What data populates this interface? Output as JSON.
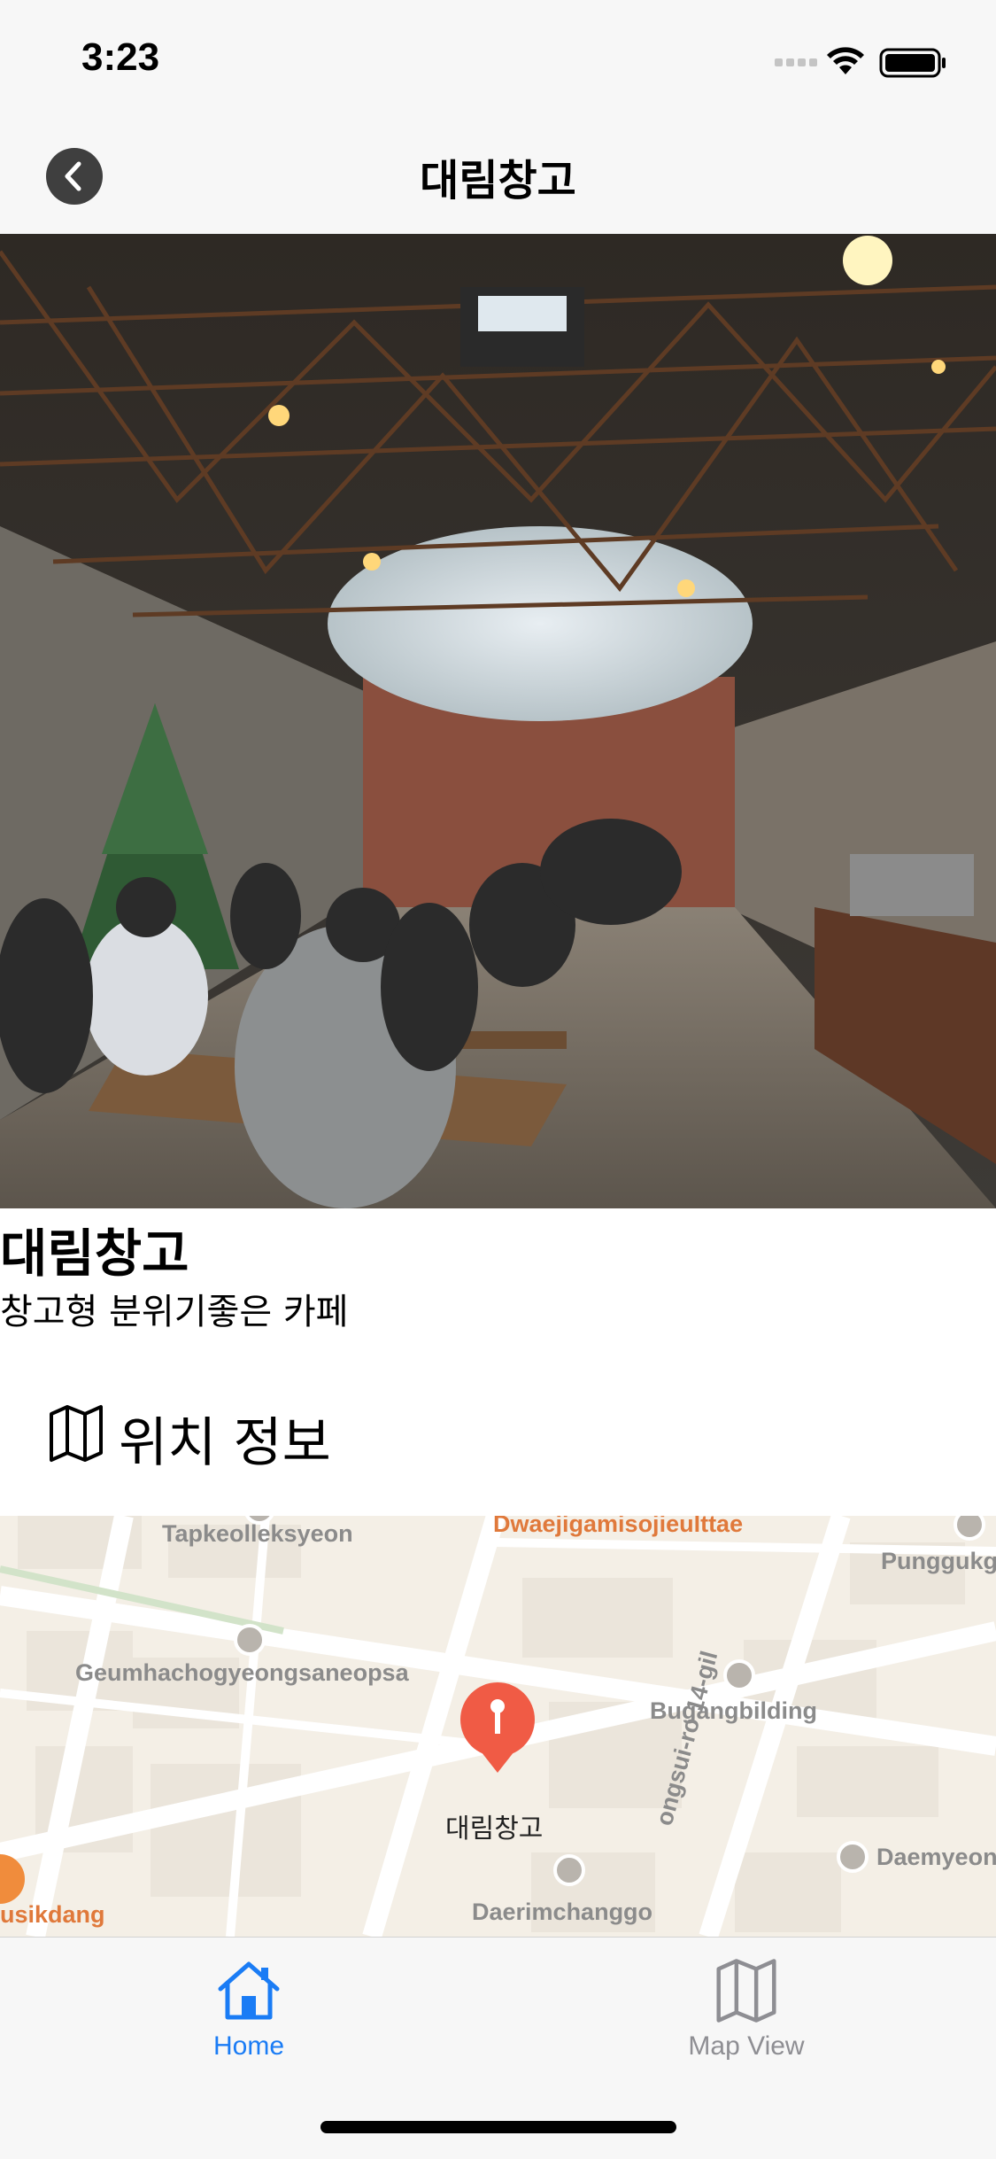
{
  "status_bar": {
    "time": "3:23"
  },
  "nav": {
    "title": "대림창고",
    "back_icon": "chevron-left-icon"
  },
  "place": {
    "name": "대림창고",
    "description": "창고형 분위기좋은 카페"
  },
  "location_section": {
    "icon": "map-icon",
    "title": "위치 정보"
  },
  "map": {
    "pin_label": "대림창고",
    "labels": [
      "Tapkeolleksyeon",
      "Dwaejigamisojieulttae",
      "Punggukg",
      "Geumhachogyeongsaneopsa",
      "Bugangbilding",
      "ongsui-ro 14-gil",
      "Daemyeon",
      "usikdang",
      "Daerimchanggo"
    ],
    "colors": {
      "road": "#ffffff",
      "block": "#ebe5db",
      "pin": "#f05b45",
      "poi": "#e0793b"
    }
  },
  "tabs": [
    {
      "label": "Home",
      "icon": "home-icon",
      "active": true
    },
    {
      "label": "Map View",
      "icon": "map-icon",
      "active": false
    }
  ],
  "colors": {
    "accent": "#1a7cf5",
    "inactive": "#8e8e93"
  }
}
